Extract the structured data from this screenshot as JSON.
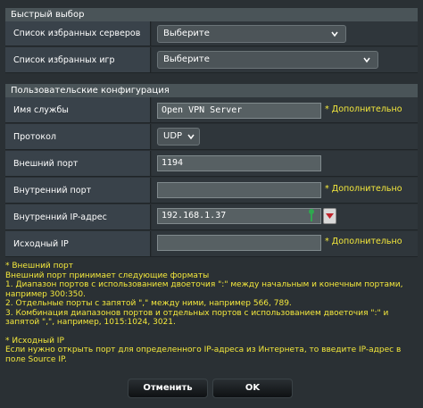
{
  "quick_select": {
    "title": "Быстрый выбор",
    "favorite_servers_label": "Список избранных серверов",
    "favorite_servers_value": "Выберите",
    "favorite_games_label": "Список избранных игр",
    "favorite_games_value": "Выберите"
  },
  "user_config": {
    "title": "Пользовательские конфигурация",
    "service_name_label": "Имя службы",
    "service_name_value": "Open VPN Server",
    "service_name_hint": "* Дополнительно",
    "protocol_label": "Протокол",
    "protocol_value": "UDP",
    "external_port_label": "Внешний порт",
    "external_port_value": "1194",
    "internal_port_label": "Внутренний порт",
    "internal_port_value": "",
    "internal_port_hint": "* Дополнительно",
    "internal_ip_label": "Внутренний IP-адрес",
    "internal_ip_value": "192.168.1.37",
    "source_ip_label": "Исходный IP",
    "source_ip_value": "",
    "source_ip_hint": "* Дополнительно"
  },
  "notes": {
    "ext_port_title": "* Внешний порт",
    "ext_port_intro": "Внешний порт принимает следующие форматы",
    "ext_port_1": "1. Диапазон портов с использованием двоеточия \":\" между начальным и конечным портами, например 300:350.",
    "ext_port_2": "2. Отдельные порты с запятой \",\" между ними, например 566, 789.",
    "ext_port_3": "3. Комбинация диапазонов портов и отдельных портов с использованием двоеточия \":\" и запятой \",\", например, 1015:1024, 3021.",
    "source_ip_title": "* Исходный IP",
    "source_ip_text": "Если нужно открыть порт для определенного IP-адреса из Интернета, то введите IP-адрес в поле Source IP."
  },
  "buttons": {
    "cancel": "Отменить",
    "ok": "OK"
  },
  "colors": {
    "background": "#2a3034",
    "hint": "#f4e83c",
    "header": "#4a5458"
  }
}
